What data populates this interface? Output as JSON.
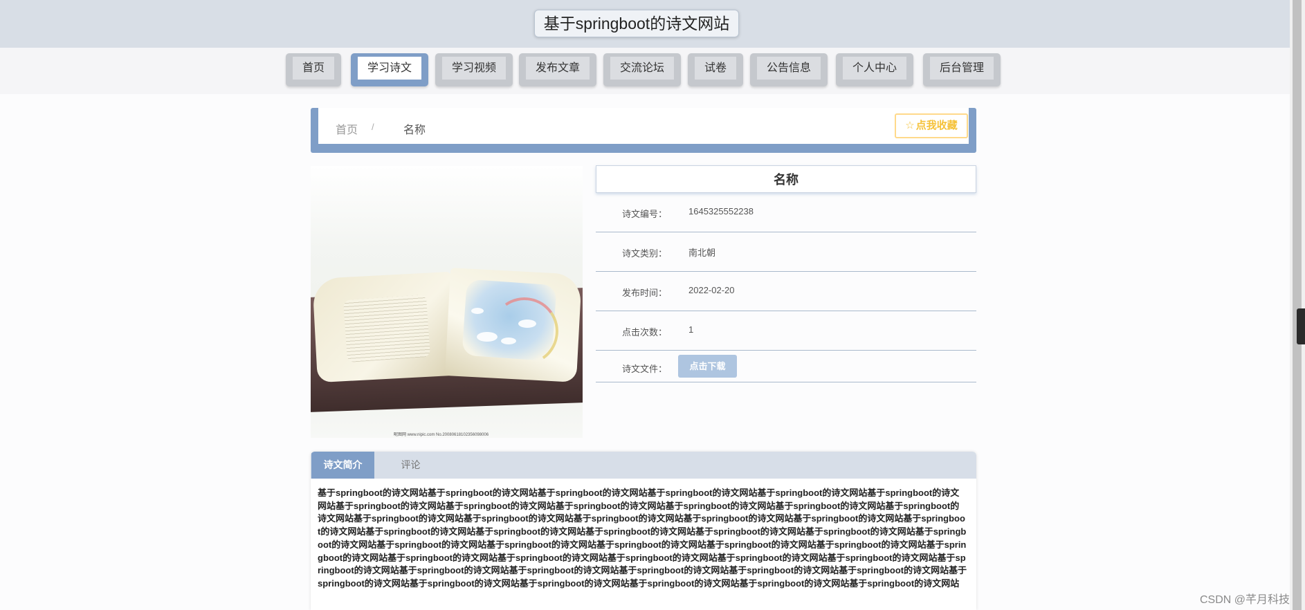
{
  "site": {
    "title": "基于springboot的诗文网站"
  },
  "nav": {
    "items": [
      "首页",
      "学习诗文",
      "学习视频",
      "发布文章",
      "交流论坛",
      "试卷",
      "公告信息",
      "个人中心",
      "后台管理"
    ],
    "active": "学习诗文"
  },
  "breadcrumb": {
    "home": "首页",
    "separator": "/",
    "current": "名称"
  },
  "favorite_button": {
    "icon": "star-outline-icon",
    "label": "点我收藏"
  },
  "cover": {
    "caption": "昵图网 www.nipic.com  No.20080618102356098006"
  },
  "detail": {
    "title": "名称",
    "fields": [
      {
        "label": "诗文编号：",
        "value": "1645325552238"
      },
      {
        "label": "诗文类别：",
        "value": "南北朝"
      },
      {
        "label": "发布时间：",
        "value": "2022-02-20"
      },
      {
        "label": "点击次数：",
        "value": "1"
      }
    ],
    "file_label": "诗文文件：",
    "download_label": "点击下载"
  },
  "tabs": [
    {
      "label": "诗文简介",
      "active": true
    },
    {
      "label": "评论",
      "active": false
    }
  ],
  "intro_text": "基于springboot的诗文网站基于springboot的诗文网站基于springboot的诗文网站基于springboot的诗文网站基于springboot的诗文网站基于springboot的诗文网站基于springboot的诗文网站基于springboot的诗文网站基于springboot的诗文网站基于springboot的诗文网站基于springboot的诗文网站基于springboot的诗文网站基于springboot的诗文网站基于springboot的诗文网站基于springboot的诗文网站基于springboot的诗文网站基于springboot的诗文网站基于springboot的诗文网站基于springboot的诗文网站基于springboot的诗文网站基于springboot的诗文网站基于springboot的诗文网站基于springboot的诗文网站基于springboot的诗文网站基于springboot的诗文网站基于springboot的诗文网站基于springboot的诗文网站基于springboot的诗文网站基于springboot的诗文网站基于springboot的诗文网站基于springboot的诗文网站基于springboot的诗文网站基于springboot的诗文网站基于springboot的诗文网站基于springboot的诗文网站基于springboot的诗文网站基于springboot的诗文网站基于springboot的诗文网站基于springboot的诗文网站基于springboot的诗文网站基于springboot的诗文网站基于springboot的诗文网站基于springboot的诗文网站基于springboot的诗文网站基于springboot的诗文网站基于springboot的诗文网站基于springboot的诗文网站",
  "watermark": "CSDN @芊月科技",
  "colors": {
    "accent": "#7f9ec7",
    "header_bg": "#d8dee6",
    "favorite": "#f5c23a",
    "download_btn": "#aec5e0"
  }
}
